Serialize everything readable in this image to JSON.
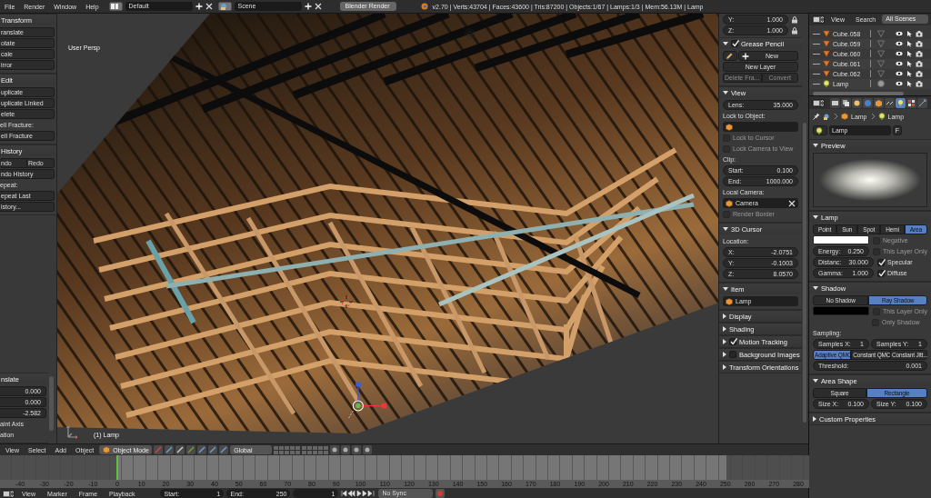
{
  "menu_bar": {
    "menus": [
      "File",
      "Render",
      "Window",
      "Help"
    ],
    "layout": "Default",
    "scene": "Scene",
    "engine": "Blender Render",
    "stats": "v2.70 | Verts:43704 | Faces:43600 | Tris:87200 | Objects:1/67 | Lamps:1/3 | Mem:56.13M | Lamp"
  },
  "tool_shelf": {
    "panels": [
      {
        "title": "Transform",
        "rows": [
          {
            "kind": "button",
            "label": "ranslate"
          },
          {
            "kind": "button",
            "label": "otate"
          },
          {
            "kind": "button",
            "label": "cale"
          },
          {
            "kind": "button",
            "label": "irror"
          }
        ]
      },
      {
        "title": "Edit",
        "rows": [
          {
            "kind": "button",
            "label": "uplicate"
          },
          {
            "kind": "button",
            "label": "uplicate Linked"
          },
          {
            "kind": "button",
            "label": "elete"
          },
          {
            "kind": "label",
            "label": "ell Fracture:"
          },
          {
            "kind": "button",
            "label": "ell Fracture"
          }
        ]
      },
      {
        "title": "History",
        "rows": [
          {
            "kind": "buttons",
            "items": [
              {
                "label": "ndo"
              },
              {
                "label": "Redo"
              }
            ]
          },
          {
            "kind": "button",
            "label": "ndo History"
          },
          {
            "kind": "label",
            "label": "epeat:"
          },
          {
            "kind": "button",
            "label": "epeat Last"
          },
          {
            "kind": "button",
            "label": "istory..."
          }
        ]
      }
    ],
    "operator": {
      "title": "nslate",
      "rows": [
        {
          "kind": "field",
          "value": "0.000"
        },
        {
          "kind": "field",
          "value": "0.000"
        },
        {
          "kind": "field",
          "value": "-2.582"
        },
        {
          "kind": "label",
          "label": "aint Axis"
        },
        {
          "kind": "label",
          "label": "ation"
        }
      ]
    }
  },
  "viewport": {
    "view_name": "User Persp",
    "object_label": "(1) Lamp"
  },
  "sidebar": {
    "top_fields": [
      {
        "label": "Y:",
        "value": "1.000"
      },
      {
        "label": "Z:",
        "value": "1.000"
      }
    ],
    "panels": [
      {
        "title": "Grease Pencil",
        "expanded": true,
        "checked": true,
        "rows": [
          {
            "kind": "new",
            "label": "New"
          },
          {
            "kind": "button",
            "label": "New Layer"
          },
          {
            "kind": "buttons",
            "items": [
              {
                "label": "Delete Fra...",
                "disabled": true
              },
              {
                "label": "Convert",
                "disabled": true
              }
            ]
          }
        ]
      },
      {
        "title": "View",
        "expanded": true,
        "rows": [
          {
            "kind": "field",
            "label": "Lens:",
            "value": "35.000"
          },
          {
            "kind": "label",
            "label": "Lock to Object:"
          },
          {
            "kind": "name"
          },
          {
            "kind": "check",
            "label": "Lock to Cursor",
            "checked": false,
            "disabled": true
          },
          {
            "kind": "check",
            "label": "Lock Camera to View",
            "checked": false,
            "disabled": true
          },
          {
            "kind": "label",
            "label": "Clip:"
          },
          {
            "kind": "field",
            "label": "Start:",
            "value": "0.100"
          },
          {
            "kind": "field",
            "label": "End:",
            "value": "1000.000"
          },
          {
            "kind": "label",
            "label": "Local Camera:"
          },
          {
            "kind": "name",
            "value": "Camera",
            "clear": true
          },
          {
            "kind": "check",
            "label": "Render Border",
            "checked": false,
            "disabled": true
          }
        ]
      },
      {
        "title": "3D Cursor",
        "expanded": true,
        "rows": [
          {
            "kind": "label",
            "label": "Location:"
          },
          {
            "kind": "field",
            "label": "X:",
            "value": "-2.0751"
          },
          {
            "kind": "field",
            "label": "Y:",
            "value": "-0.1003"
          },
          {
            "kind": "field",
            "label": "Z:",
            "value": "8.0570"
          }
        ]
      },
      {
        "title": "Item",
        "expanded": true,
        "rows": [
          {
            "kind": "name",
            "value": "Lamp"
          }
        ]
      },
      {
        "title": "Display",
        "expanded": false
      },
      {
        "title": "Shading",
        "expanded": false
      },
      {
        "title": "Motion Tracking",
        "expanded": false,
        "checked": true
      },
      {
        "title": "Background Images",
        "expanded": false,
        "checked": false
      },
      {
        "title": "Transform Orientations",
        "expanded": false
      }
    ]
  },
  "view_header": {
    "menus": [
      "View",
      "Select",
      "Add",
      "Object"
    ],
    "mode": "Object Mode",
    "orientation": "Global"
  },
  "timeline": {
    "ruler": [
      {
        "label": "-40",
        "current": false
      },
      {
        "label": "-30",
        "current": false
      },
      {
        "label": "-20",
        "current": false
      },
      {
        "label": "-10",
        "current": false
      },
      {
        "label": "0",
        "current": true
      },
      {
        "label": "10",
        "current": false
      },
      {
        "label": "20",
        "current": false
      },
      {
        "label": "30",
        "current": false
      },
      {
        "label": "40",
        "current": false
      },
      {
        "label": "50",
        "current": false
      },
      {
        "label": "60",
        "current": false
      },
      {
        "label": "70",
        "current": false
      },
      {
        "label": "80",
        "current": false
      },
      {
        "label": "90",
        "current": false
      },
      {
        "label": "100",
        "current": false
      },
      {
        "label": "110",
        "current": false
      },
      {
        "label": "120",
        "current": false
      },
      {
        "label": "130",
        "current": false
      },
      {
        "label": "140",
        "current": false
      },
      {
        "label": "150",
        "current": false
      },
      {
        "label": "160",
        "current": false
      },
      {
        "label": "170",
        "current": false
      },
      {
        "label": "180",
        "current": false
      },
      {
        "label": "190",
        "current": false
      },
      {
        "label": "200",
        "current": false
      },
      {
        "label": "210",
        "current": false
      },
      {
        "label": "220",
        "current": false
      },
      {
        "label": "230",
        "current": false
      },
      {
        "label": "240",
        "current": false
      },
      {
        "label": "250",
        "current": false
      },
      {
        "label": "260",
        "current": false
      },
      {
        "label": "270",
        "current": false
      },
      {
        "label": "280",
        "current": false
      }
    ],
    "menus": [
      "View",
      "Marker",
      "Frame",
      "Playback"
    ],
    "start": {
      "label": "Start:",
      "value": "1"
    },
    "end": {
      "label": "End:",
      "value": "250"
    },
    "frame": "1",
    "sync": "No Sync"
  },
  "outliner": {
    "menus": [
      "View",
      "Search"
    ],
    "filter": "All Scenes",
    "items": [
      {
        "name": "Cube.058",
        "kind": "mesh"
      },
      {
        "name": "Cube.059",
        "kind": "mesh"
      },
      {
        "name": "Cube.060",
        "kind": "mesh"
      },
      {
        "name": "Cube.061",
        "kind": "mesh"
      },
      {
        "name": "Cube.062",
        "kind": "mesh"
      },
      {
        "name": "Lamp",
        "kind": "lamp"
      }
    ]
  },
  "properties": {
    "context_tabs": [
      {
        "selected": false
      },
      {
        "selected": false
      },
      {
        "selected": false
      },
      {
        "selected": false
      },
      {
        "selected": false
      },
      {
        "selected": false
      },
      {
        "selected": true
      },
      {
        "selected": false
      },
      {
        "selected": false
      }
    ],
    "breadcrumb": [
      "Lamp",
      "Lamp"
    ],
    "datablock": {
      "name": "Lamp",
      "fake_user": "F"
    },
    "panels": [
      {
        "title": "Preview",
        "expanded": true,
        "rows": [
          {
            "kind": "preview"
          }
        ]
      },
      {
        "title": "Lamp",
        "expanded": true,
        "rows": [
          {
            "kind": "buttons",
            "items": [
              {
                "label": "Point",
                "selected": false
              },
              {
                "label": "Sun",
                "selected": false
              },
              {
                "label": "Spot",
                "selected": false
              },
              {
                "label": "Hemi",
                "selected": false
              },
              {
                "label": "Area",
                "selected": true
              }
            ]
          },
          {
            "kind": "pair",
            "left": {
              "kind": "color",
              "color": "#ffffff"
            },
            "right": {
              "kind": "check",
              "label": "Negative",
              "checked": false,
              "disabled": true
            }
          },
          {
            "kind": "pair",
            "left": {
              "kind": "field",
              "label": "Energy:",
              "value": "0.250"
            },
            "right": {
              "kind": "check",
              "label": "This Layer Only",
              "checked": false,
              "disabled": true
            }
          },
          {
            "kind": "pair",
            "left": {
              "kind": "field",
              "label": "Distanc:",
              "value": "30.000"
            },
            "right": {
              "kind": "check",
              "label": "Specular",
              "checked": true,
              "disabled": false
            }
          },
          {
            "kind": "pair",
            "left": {
              "kind": "field",
              "label": "Gamma:",
              "value": "1.000"
            },
            "right": {
              "kind": "check",
              "label": "Diffuse",
              "checked": true,
              "disabled": false
            }
          }
        ]
      },
      {
        "title": "Shadow",
        "expanded": true,
        "rows": [
          {
            "kind": "buttons",
            "items": [
              {
                "label": "No Shadow",
                "selected": false
              },
              {
                "label": "Ray Shadow",
                "selected": true
              }
            ]
          },
          {
            "kind": "pair",
            "left": {
              "kind": "color",
              "color": "#000000"
            },
            "right": {
              "kind": "check",
              "label": "This Layer Only",
              "checked": false,
              "disabled": true
            }
          },
          {
            "kind": "pair",
            "right": {
              "kind": "check",
              "label": "Only Shadow",
              "checked": false,
              "disabled": true
            }
          },
          {
            "kind": "label",
            "label": "Sampling:"
          },
          {
            "kind": "fields",
            "items": [
              {
                "label": "Samples X:",
                "value": "1"
              },
              {
                "label": "Samples Y:",
                "value": "1"
              }
            ]
          },
          {
            "kind": "buttons",
            "items": [
              {
                "label": "Adaptive QMC",
                "selected": true
              },
              {
                "label": "Constant QMC",
                "selected": false
              },
              {
                "label": "Constant Jitt...",
                "selected": false
              }
            ]
          },
          {
            "kind": "field",
            "label": "Threshold:",
            "value": "0.001"
          }
        ]
      },
      {
        "title": "Area Shape",
        "expanded": true,
        "rows": [
          {
            "kind": "buttons",
            "items": [
              {
                "label": "Square",
                "selected": false
              },
              {
                "label": "Rectangle",
                "selected": true
              }
            ]
          },
          {
            "kind": "fields",
            "items": [
              {
                "label": "Size X:",
                "value": "0.100"
              },
              {
                "label": "Size Y:",
                "value": "0.100"
              }
            ]
          }
        ]
      },
      {
        "title": "Custom Properties",
        "expanded": false
      }
    ]
  }
}
